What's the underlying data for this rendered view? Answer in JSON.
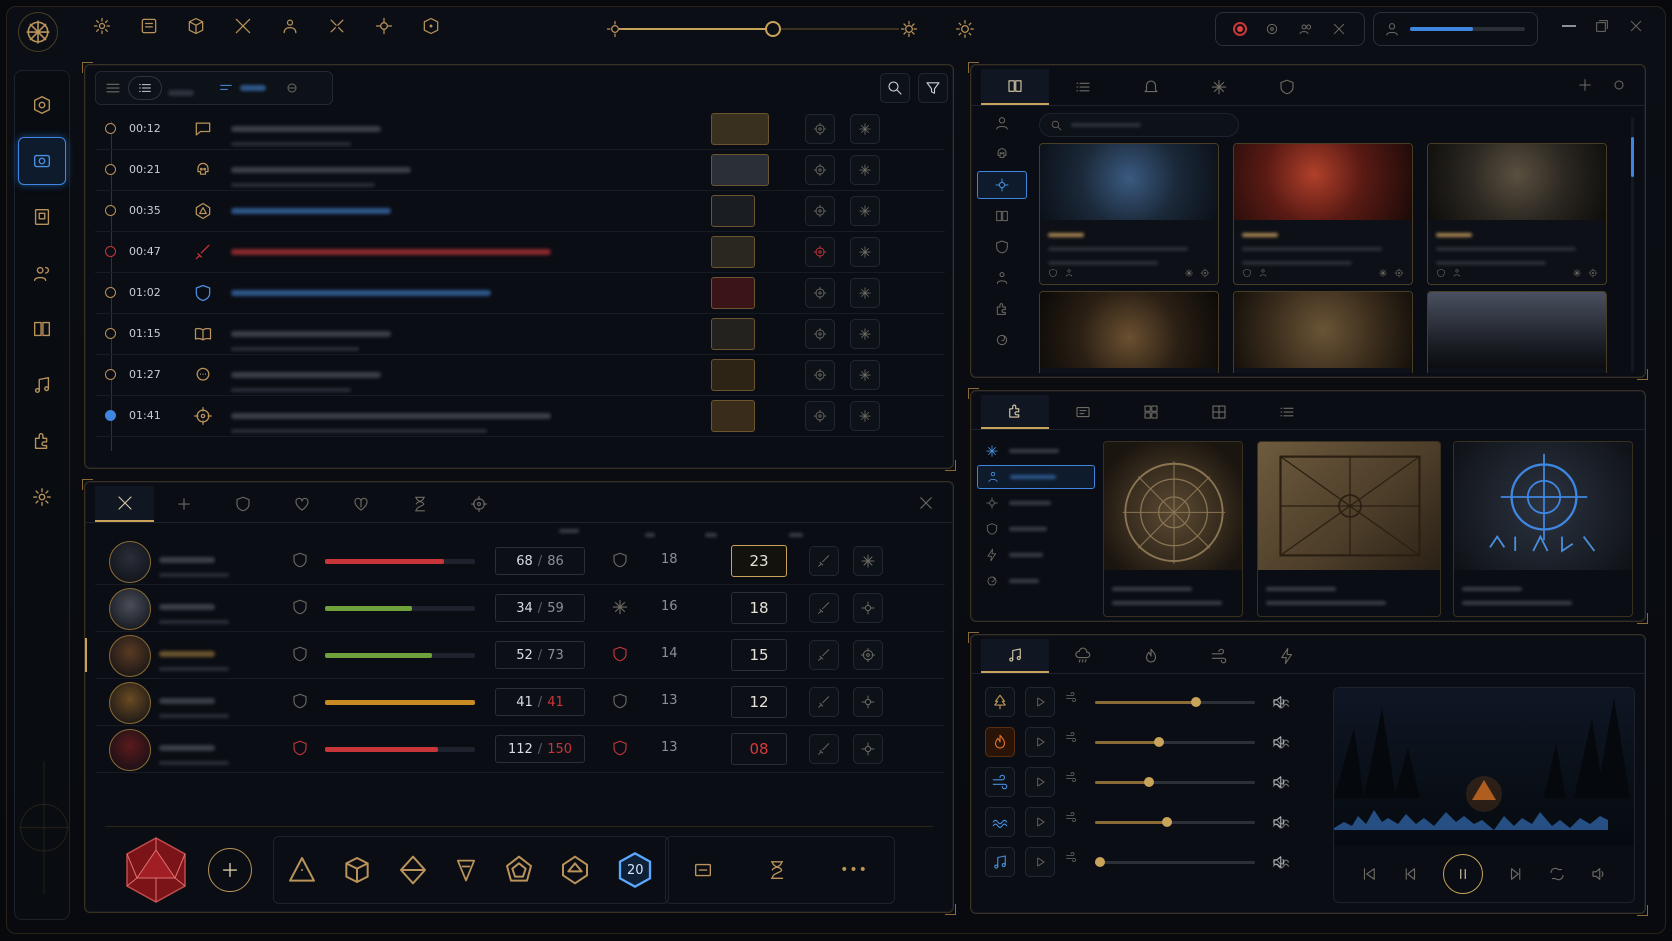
{
  "topbar": {
    "icons": [
      "settings-gear-icon",
      "map-scroll-icon",
      "cube-icon",
      "crossed-swords-icon",
      "party-icon",
      "battle-icon",
      "monster-icon",
      "dice-cube-icon"
    ],
    "time_slider_progress": 0.55,
    "volume_level": 0.55
  },
  "sidebar": {
    "items": [
      "campaign-icon",
      "encounter-icon",
      "journal-icon",
      "characters-icon",
      "lore-book-icon",
      "music-icon",
      "puzzle-icon",
      "settings-icon"
    ],
    "active_index": 1
  },
  "log": {
    "entries": [
      {
        "time": "00:12",
        "icon": "chat-bubble-icon",
        "color": "gold",
        "bar": "gray"
      },
      {
        "time": "00:21",
        "icon": "skull-icon",
        "color": "gold",
        "bar": "gray"
      },
      {
        "time": "00:35",
        "icon": "d20-icon",
        "color": "gold",
        "bar": "blue"
      },
      {
        "time": "00:47",
        "icon": "sword-icon",
        "color": "red",
        "bar": "red"
      },
      {
        "time": "01:02",
        "icon": "shield-icon",
        "color": "blue",
        "bar": "blue"
      },
      {
        "time": "01:15",
        "icon": "open-book-icon",
        "color": "gold",
        "bar": "gray"
      },
      {
        "time": "01:27",
        "icon": "speech-bubble-icon",
        "color": "gold",
        "bar": "gray"
      },
      {
        "time": "01:41",
        "icon": "target-icon",
        "color": "gold",
        "bar": "gray"
      }
    ]
  },
  "party": {
    "tabs": [
      "combat-icon",
      "add-icon",
      "shield-icon",
      "heart-icon",
      "heart-alt-icon",
      "hourglass-icon",
      "target-icon"
    ],
    "members": [
      {
        "hp": "68",
        "max": "86",
        "ac": "18",
        "init": "23",
        "bar_color": "#c8363a",
        "fill": 0.79,
        "max_color": "#8b8f98",
        "init_color": "#e6e2d6",
        "highlight": true
      },
      {
        "hp": "34",
        "max": "59",
        "ac": "16",
        "init": "18",
        "bar_color": "#6fa23a",
        "fill": 0.58,
        "max_color": "#8b8f98",
        "init_color": "#e6e2d6",
        "highlight": false
      },
      {
        "hp": "52",
        "max": "73",
        "ac": "14",
        "init": "15",
        "bar_color": "#6fa23a",
        "fill": 0.71,
        "max_color": "#8b8f98",
        "init_color": "#e6e2d6",
        "highlight": false
      },
      {
        "hp": "41",
        "max": "41",
        "ac": "13",
        "init": "12",
        "bar_color": "#c88a22",
        "fill": 1.0,
        "max_color": "#c8363a",
        "init_color": "#e6e2d6",
        "highlight": false
      },
      {
        "hp": "112",
        "max": "150",
        "ac": "13",
        "init": "08",
        "bar_color": "#c8363a",
        "fill": 0.75,
        "max_color": "#c8363a",
        "init_color": "#d83a3a",
        "highlight": false
      }
    ],
    "separator": "/"
  },
  "dice": {
    "big_die": "d20-red",
    "active_die_label": "20",
    "more": "•••"
  },
  "library": {
    "tabs": [
      "book-icon",
      "list-icon",
      "bell-icon",
      "star-icon",
      "shield-icon"
    ],
    "side": [
      "person-icon",
      "skull-icon",
      "monster-icon",
      "book-icon",
      "shield-icon",
      "party-icon",
      "puzzle-icon",
      "swirl-icon"
    ]
  },
  "maps": {
    "tabs": [
      "puzzle-icon",
      "map-list-icon",
      "grid-icon",
      "layout-icon",
      "list-icon"
    ]
  },
  "audio": {
    "tabs": [
      "music-note-icon",
      "rain-icon",
      "fire-icon",
      "wind-icon",
      "lightning-icon"
    ],
    "tracks": [
      {
        "icon": "tree-icon",
        "level": 0.63
      },
      {
        "icon": "fire-icon",
        "level": 0.4
      },
      {
        "icon": "wind-icon",
        "level": 0.34
      },
      {
        "icon": "wave-icon",
        "level": 0.45
      },
      {
        "icon": "music-note-icon",
        "level": 0.03
      }
    ]
  }
}
